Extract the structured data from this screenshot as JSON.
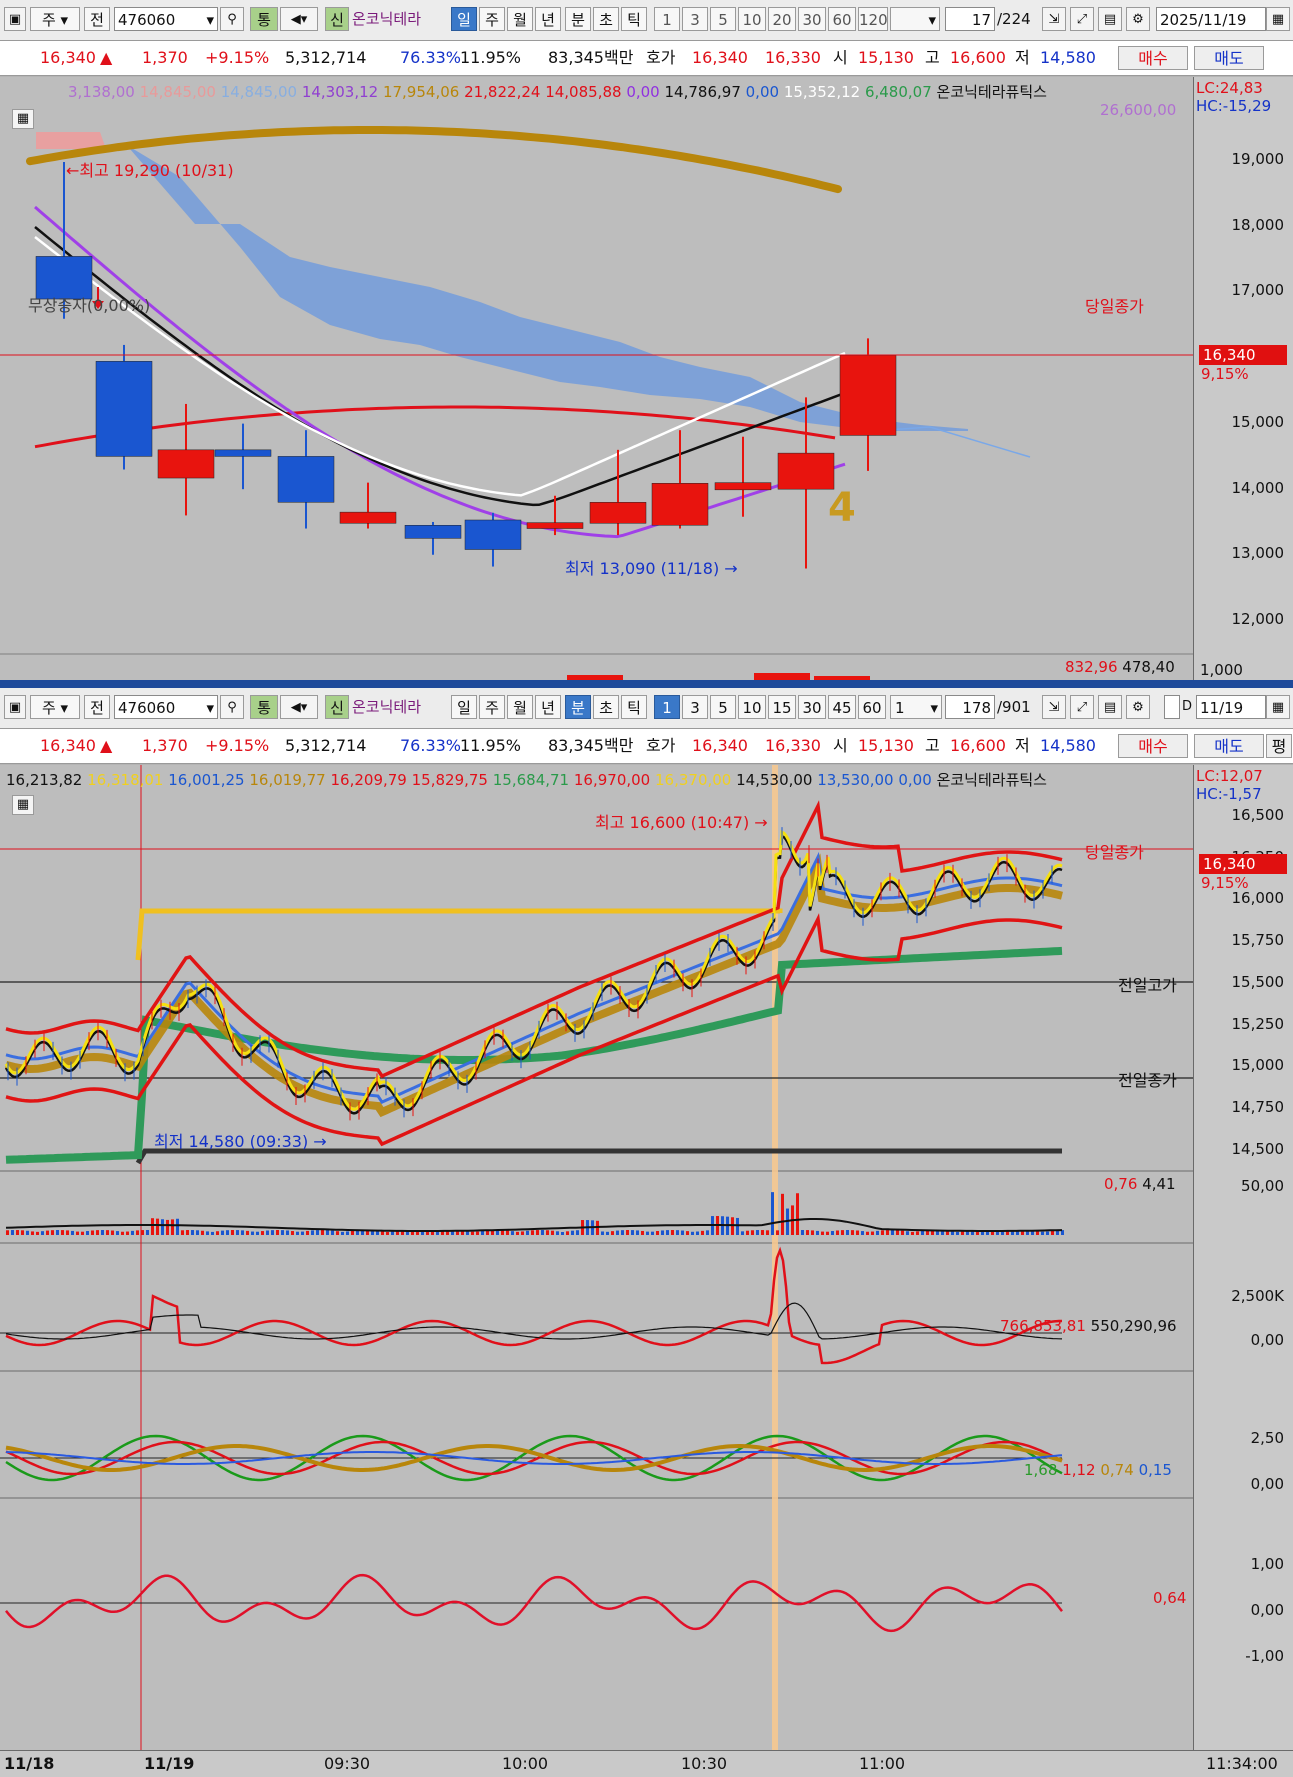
{
  "top": {
    "toolbar": {
      "type_label": "주",
      "prev_label": "전",
      "code": "476060",
      "tong_label": "통",
      "sin_label": "신",
      "name": "온코닉테라",
      "periods": [
        "일",
        "주",
        "월",
        "년",
        "분",
        "초",
        "틱"
      ],
      "active_period": "일",
      "numbers": [
        "1",
        "3",
        "5",
        "10",
        "20",
        "30",
        "60",
        "120"
      ],
      "count": "17",
      "total": "/224",
      "date": "2025/11/19"
    },
    "quote": {
      "price": "16,340",
      "arrow": "▲",
      "change": "1,370",
      "pct": "+9.15%",
      "volume": "5,312,714",
      "ratio1": "76.33%",
      "ratio2": "11.95%",
      "amount": "83,345백만",
      "hoga_label": "호가",
      "ask": "16,340",
      "bid": "16,330",
      "open_label": "시",
      "open": "15,130",
      "high_label": "고",
      "high": "16,600",
      "low_label": "저",
      "low": "14,580",
      "buy_label": "매수",
      "sell_label": "매도"
    },
    "legend": [
      "3,138,00",
      "14,845,00",
      "14,845,00",
      "14,303,12",
      "17,954,06",
      "21,822,24",
      "14,085,88",
      "0,00",
      "14,786,97",
      "0,00",
      "15,352,12",
      "6,480,07",
      "온코닉테라퓨틱스"
    ],
    "legend_sub": "26,600,00",
    "lc": "LC:24,83",
    "hc": "HC:-15,29",
    "yticks": [
      "19,000",
      "18,000",
      "17,000",
      "16,000",
      "15,000",
      "14,000",
      "13,000",
      "12,000"
    ],
    "close_label": "당일종가",
    "price_box": "16,340",
    "price_pct": "9,15%",
    "max_label": "최고 19,290 (10/31)",
    "min_label": "최저 13,090 (11/18)",
    "rights_label": "무상증자(0,00%)",
    "vol_values": [
      "832,96",
      "478,40"
    ],
    "vol_tick": "1,000",
    "wave": "4"
  },
  "bottom": {
    "toolbar": {
      "type_label": "주",
      "prev_label": "전",
      "code": "476060",
      "tong_label": "통",
      "sin_label": "신",
      "name": "온코닉테라",
      "periods": [
        "일",
        "주",
        "월",
        "년",
        "분",
        "초",
        "틱"
      ],
      "active_period": "분",
      "numbers": [
        "1",
        "3",
        "5",
        "10",
        "15",
        "30",
        "45",
        "60"
      ],
      "unit": "1",
      "count": "178",
      "total": "/901",
      "d_label": "D",
      "date": "11/19"
    },
    "quote": {
      "price": "16,340",
      "arrow": "▲",
      "change": "1,370",
      "pct": "+9.15%",
      "volume": "5,312,714",
      "ratio1": "76.33%",
      "ratio2": "11.95%",
      "amount": "83,345백만",
      "hoga_label": "호가",
      "ask": "16,340",
      "bid": "16,330",
      "open_label": "시",
      "open": "15,130",
      "high_label": "고",
      "high": "16,600",
      "low_label": "저",
      "low": "14,580",
      "buy_label": "매수",
      "sell_label": "매도",
      "extra_label": "평"
    },
    "legend": [
      "16,213,82",
      "16,318,01",
      "16,001,25",
      "16,019,77",
      "16,209,79",
      "15,829,75",
      "15,684,71",
      "16,970,00",
      "16,370,00",
      "14,530,00",
      "13,530,00",
      "0,00",
      "온코닉테라퓨틱스"
    ],
    "lc": "LC:12,07",
    "hc": "HC:-1,57",
    "yticks": [
      "16,500",
      "16,250",
      "16,000",
      "15,750",
      "15,500",
      "15,250",
      "15,000",
      "14,750",
      "14,500"
    ],
    "close_label": "당일종가",
    "price_box": "16,340",
    "price_pct": "9,15%",
    "prev_high_label": "전일고가",
    "prev_close_label": "전일종가",
    "max_label": "최고 16,600 (10:47)",
    "min_label": "최저 14,580 (09:33)",
    "vol": {
      "values": [
        "0,76",
        "4,41"
      ],
      "tick": "50,00"
    },
    "ind1": {
      "values": [
        "766,853,81",
        "550,290,96"
      ],
      "ticks": [
        "2,500K",
        "0,00"
      ]
    },
    "ind2": {
      "values": [
        "1,68",
        "1,12",
        "0,74",
        "0,15"
      ],
      "ticks": [
        "2,50",
        "0,00"
      ]
    },
    "ind3": {
      "value": "0,64",
      "ticks": [
        "1,00",
        "0,00",
        "-1,00"
      ]
    },
    "xlabels": [
      "11/18",
      "11/19",
      "09:30",
      "10:00",
      "10:30",
      "11:00",
      "11:34:00"
    ]
  },
  "colors": {
    "up": "#e8140e",
    "down": "#1a56d0",
    "background": "#bdbdbd",
    "toolbar": "#ececec"
  }
}
